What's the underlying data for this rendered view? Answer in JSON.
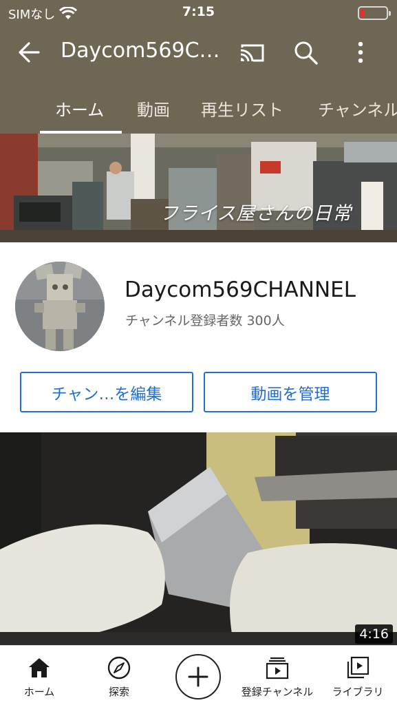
{
  "status_bar": {
    "carrier": "SIMなし",
    "time": "7:15"
  },
  "app_bar": {
    "title": "Daycom569C…",
    "icons": [
      "back-arrow-icon",
      "cast-icon",
      "search-icon",
      "more-vert-icon"
    ]
  },
  "tabs": [
    {
      "label": "ホーム",
      "active": true
    },
    {
      "label": "動画",
      "active": false
    },
    {
      "label": "再生リスト",
      "active": false
    },
    {
      "label": "チャンネル",
      "active": false
    }
  ],
  "banner": {
    "caption": "フライス屋さんの日常"
  },
  "channel": {
    "name": "Daycom569CHANNEL",
    "subscribers": "チャンネル登録者数 300人"
  },
  "actions": {
    "edit_label": "チャン…を編集",
    "manage_label": "動画を管理"
  },
  "video": {
    "duration": "4:16"
  },
  "bottom_nav": [
    {
      "label": "ホーム",
      "icon": "home-icon"
    },
    {
      "label": "探索",
      "icon": "compass-icon"
    },
    {
      "label": "",
      "icon": "create-plus-icon"
    },
    {
      "label": "登録チャンネル",
      "icon": "subscriptions-icon"
    },
    {
      "label": "ライブラリ",
      "icon": "library-icon"
    }
  ],
  "colors": {
    "header": "#6d6754",
    "accent": "#1f6fd8",
    "battery_low": "#e5302c"
  }
}
